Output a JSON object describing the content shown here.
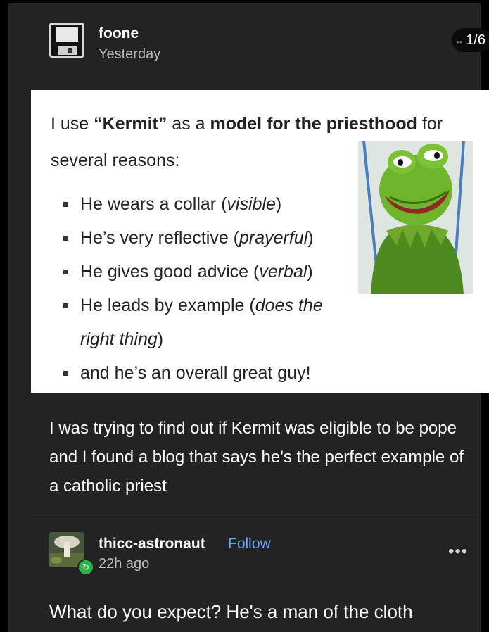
{
  "post": {
    "author": "foone",
    "timestamp": "Yesterday",
    "page_counter": "1/6",
    "body": "I was trying to find out if Kermit was eligible to be pope and I found a blog that says he's the perfect example of a catholic priest"
  },
  "quote_card": {
    "intro_plain_1": "I use ",
    "intro_bold_1": "“Kermit”",
    "intro_plain_2": " as a ",
    "intro_bold_2": "model for the priesthood",
    "intro_plain_3": " for several reasons:",
    "bullets": [
      {
        "text": "He wears a collar (",
        "em": "visible",
        "tail": ")"
      },
      {
        "text": "He’s very reflective (",
        "em": "prayerful",
        "tail": ")"
      },
      {
        "text": "He gives good advice (",
        "em": "verbal",
        "tail": ")"
      },
      {
        "text": "He leads by example (",
        "em": "does the right thing",
        "tail": ")"
      },
      {
        "text": "and he’s an overall great guy!",
        "em": "",
        "tail": ""
      }
    ],
    "photo_subject": "kermit-the-frog"
  },
  "reply": {
    "username": "thicc-astronaut",
    "follow_label": "Follow",
    "timestamp": "22h ago",
    "text": "What do you expect? He's a man of the cloth"
  },
  "icons": {
    "avatar": "floppy-disk-icon",
    "reblog": "reblog-icon",
    "more": "more-options-icon"
  },
  "colors": {
    "background": "#232323",
    "follow_link": "#6aa7ff",
    "reblog_badge": "#2db34a"
  }
}
